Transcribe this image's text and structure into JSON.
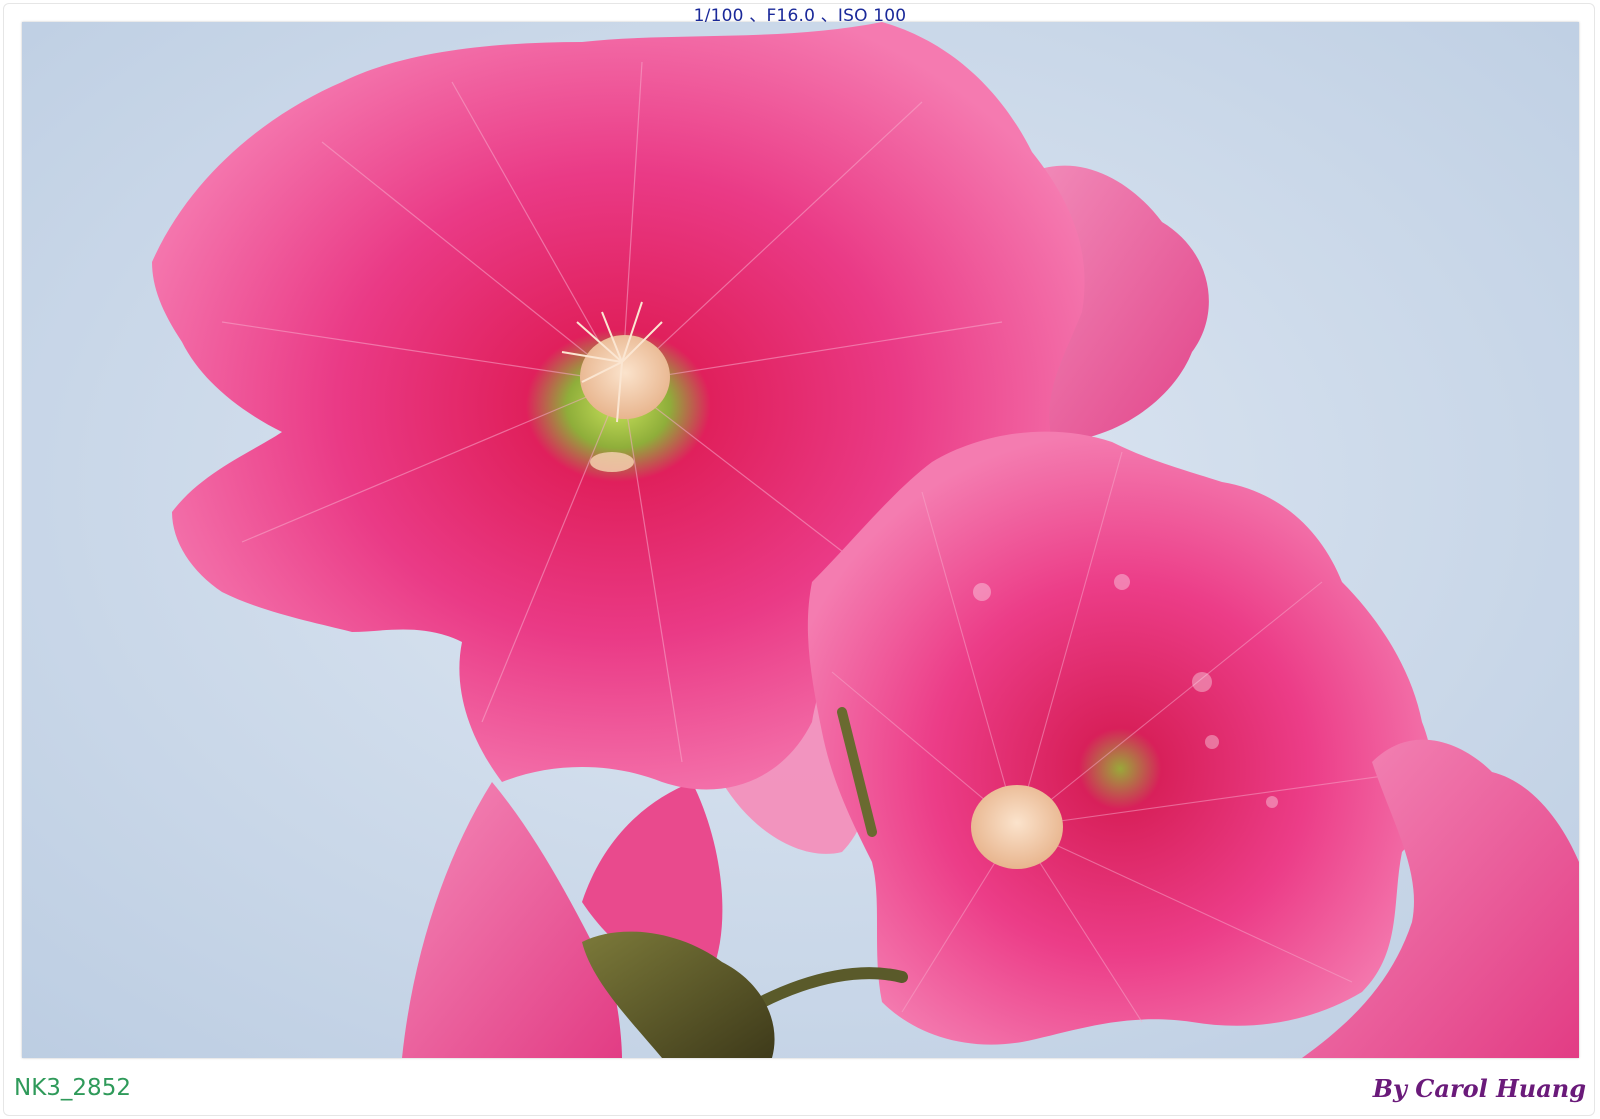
{
  "header": {
    "exif": "1/100 、F16.0 、ISO 100"
  },
  "footer": {
    "file_id": "NK3_2852",
    "byline": "By Carol Huang"
  },
  "colors": {
    "sky": "#c9d8ea",
    "petal": "#e8307c",
    "petal_light": "#f06aa2",
    "center": "#f3c9a8",
    "stem": "#5a5a2a",
    "exif_text": "#1b2a9a",
    "file_id_text": "#2f9a5a",
    "byline_text": "#6a1a7a"
  }
}
